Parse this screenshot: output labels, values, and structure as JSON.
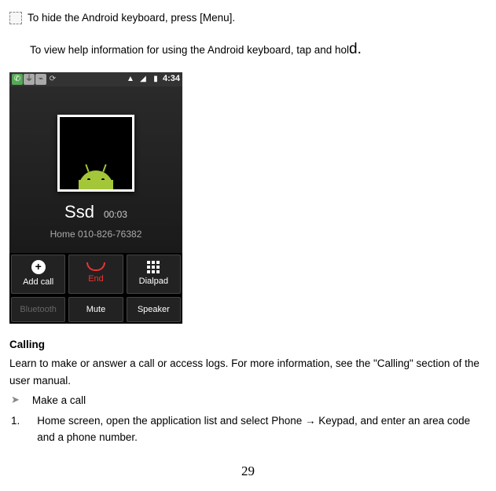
{
  "tips": {
    "hide_kb": "To hide the Android keyboard, press [Menu].",
    "help_part1": "To view help information for using the Android keyboard, tap and hol",
    "help_part2": "d."
  },
  "phone": {
    "status_time": "4:34",
    "contact_name": "Ssd",
    "call_duration": "00:03",
    "contact_number": "Home 010-826-76382",
    "buttons": {
      "add_call": "Add call",
      "end": "End",
      "dialpad": "Dialpad",
      "bluetooth": "Bluetooth",
      "mute": "Mute",
      "speaker": "Speaker"
    }
  },
  "section": {
    "heading": "Calling",
    "intro": "Learn to make or answer a call or access logs. For more information, see the \"Calling\" section of the user manual.",
    "bullet_label": "Make a call",
    "step_num": "1.",
    "step_text": "Home screen, open the application list and select Phone → Keypad, and enter an area code and a phone number."
  },
  "page_number": "29"
}
